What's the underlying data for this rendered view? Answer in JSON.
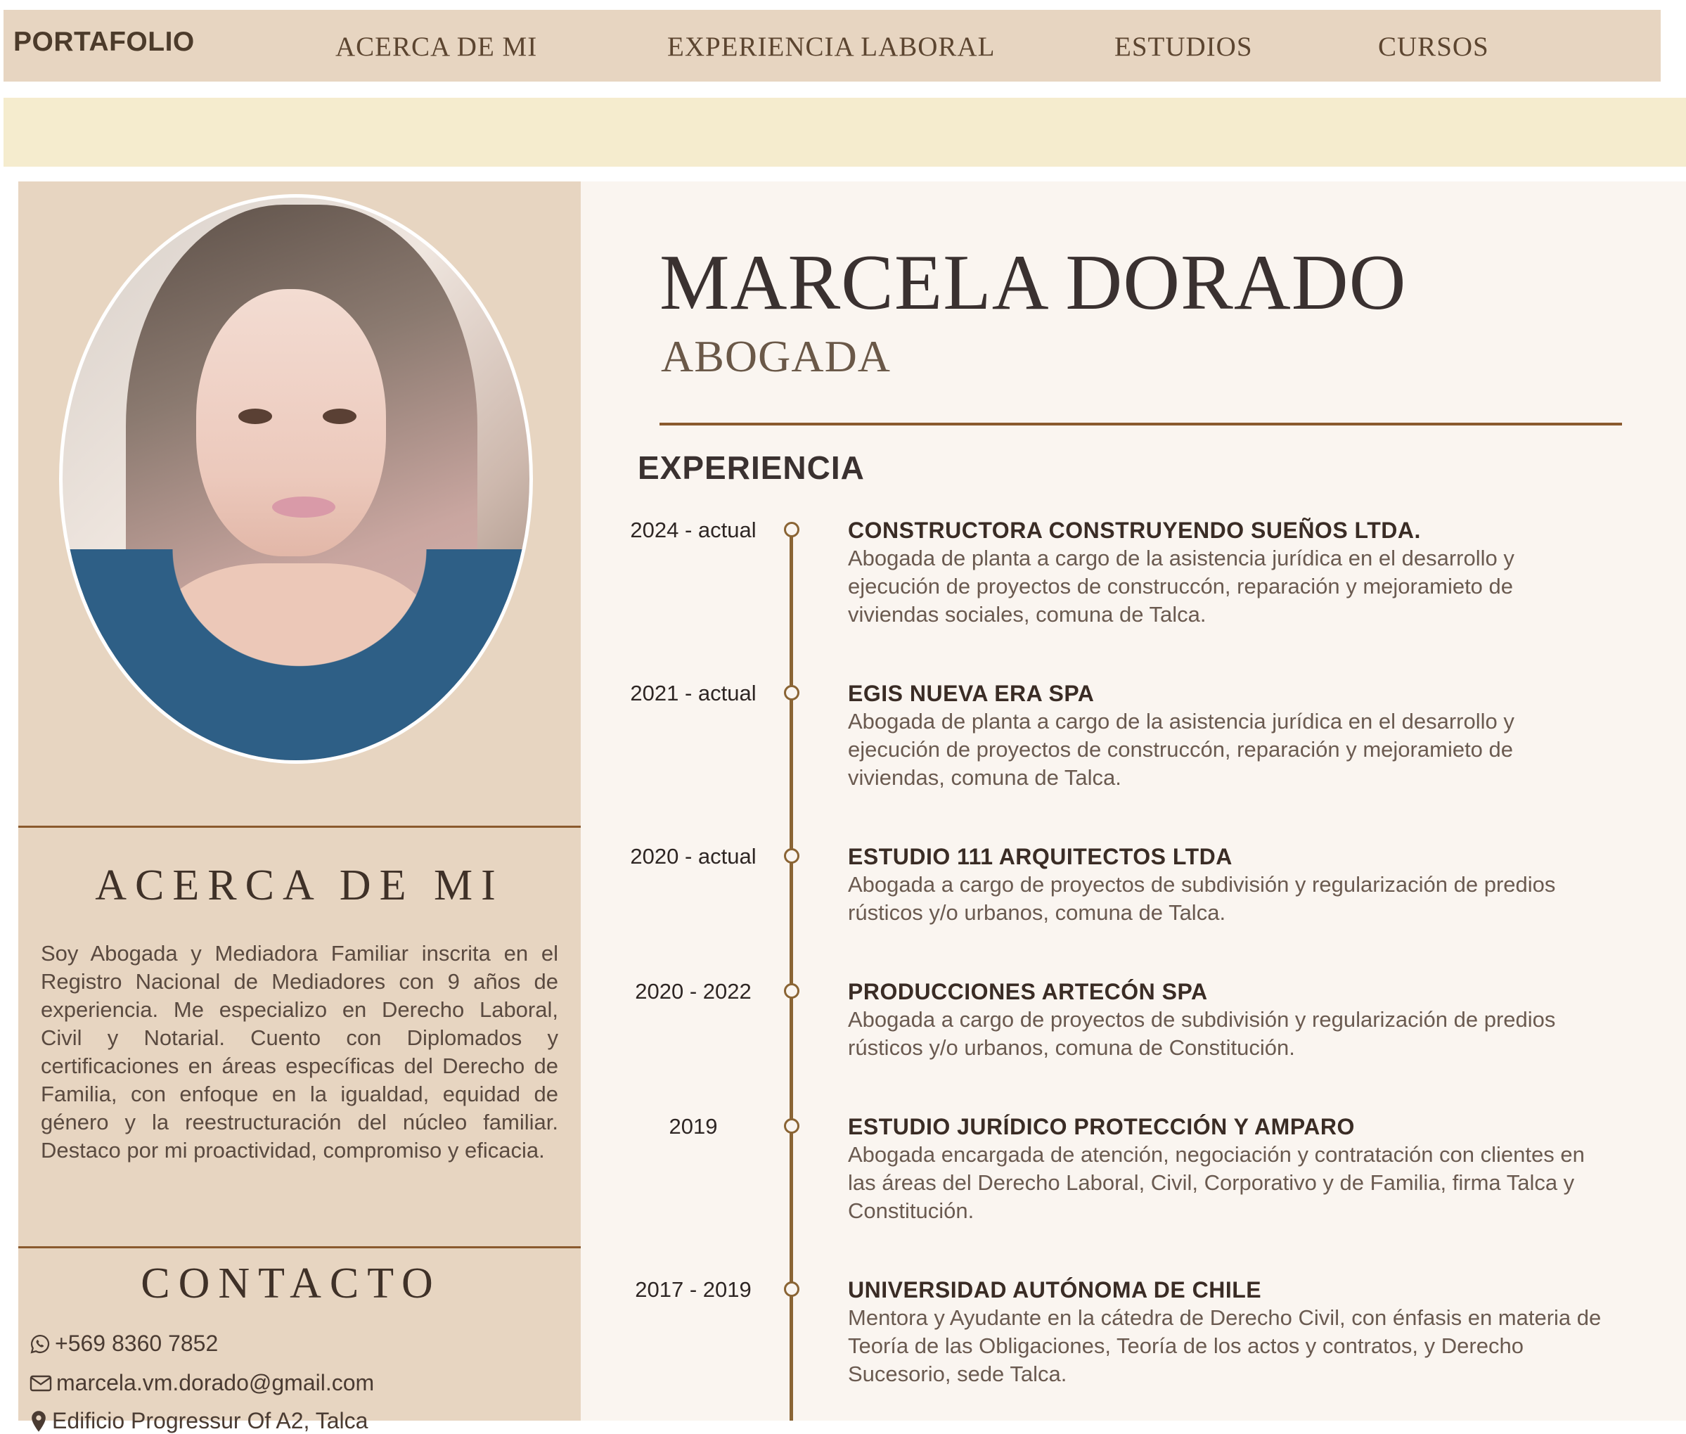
{
  "nav": {
    "brand": "PORTAFOLIO",
    "links": [
      "ACERCA DE MI",
      "EXPERIENCIA LABORAL",
      "ESTUDIOS",
      "CURSOS"
    ]
  },
  "sidebar": {
    "about_title": "ACERCA DE MI",
    "about_text": "Soy Abogada y Mediadora Familiar inscrita en el Registro Nacional de Mediadores con 9 años de experiencia. Me especializo en Derecho Laboral, Civil y Notarial. Cuento con Diplomados y certificaciones en áreas específicas del Derecho de Familia, con enfoque en la igualdad, equidad de género y la reestructuración del núcleo familiar. Destaco por mi proactividad, compromiso y eficacia.",
    "contact_title": "CONTACTO",
    "phone": "+569 8360 7852",
    "email": "marcela.vm.dorado@gmail.com",
    "address": "Edificio Progressur Of A2, Talca"
  },
  "profile": {
    "name": "MARCELA DORADO",
    "role": "ABOGADA"
  },
  "experience": {
    "title": "EXPERIENCIA",
    "items": [
      {
        "date": "2024 - actual",
        "company": "CONSTRUCTORA CONSTRUYENDO SUEÑOS LTDA.",
        "desc": [
          "Abogada de planta a cargo de la asistencia jurídica en el desarrollo y",
          "ejecución de proyectos de construccón, reparación y mejoramieto de",
          "viviendas sociales, comuna de Talca."
        ]
      },
      {
        "date": "2021 - actual",
        "company": "EGIS NUEVA ERA SPA",
        "desc": [
          "Abogada de planta a cargo de la asistencia jurídica en el desarrollo y",
          "ejecución de proyectos de construccón, reparación y mejoramieto de",
          "viviendas, comuna de Talca."
        ]
      },
      {
        "date": "2020 - actual",
        "company": "ESTUDIO 111 ARQUITECTOS LTDA",
        "desc": [
          "Abogada a cargo de proyectos de subdivisión y regularización de predios",
          "rústicos y/o urbanos, comuna de Talca."
        ]
      },
      {
        "date": "2020 - 2022",
        "company": "PRODUCCIONES ARTECÓN SPA",
        "desc": [
          "Abogada a cargo de proyectos de subdivisión y regularización de predios",
          "rústicos y/o urbanos, comuna de Constitución."
        ]
      },
      {
        "date": "2019",
        "company": "ESTUDIO JURÍDICO PROTECCIÓN Y AMPARO",
        "desc": [
          "Abogada encargada de atención, negociación y contratación con clientes en",
          "las áreas del Derecho Laboral, Civil, Corporativo y de Familia, firma Talca y",
          "Constitución."
        ]
      },
      {
        "date": "2017 - 2019",
        "company": "UNIVERSIDAD AUTÓNOMA DE CHILE",
        "desc": [
          "Mentora y Ayudante en la cátedra de Derecho Civil, con énfasis en materia de",
          "Teoría de las Obligaciones, Teoría de los actos y contratos, y Derecho",
          "Sucesorio, sede Talca."
        ]
      }
    ]
  },
  "icons": {
    "phone": "whatsapp-icon",
    "email": "envelope-icon",
    "address": "location-pin-icon"
  },
  "colors": {
    "nav_bg": "#e7d5c1",
    "band_bg": "#f5ecce",
    "main_bg": "#faf5f0",
    "accent": "#8a5a2e"
  }
}
